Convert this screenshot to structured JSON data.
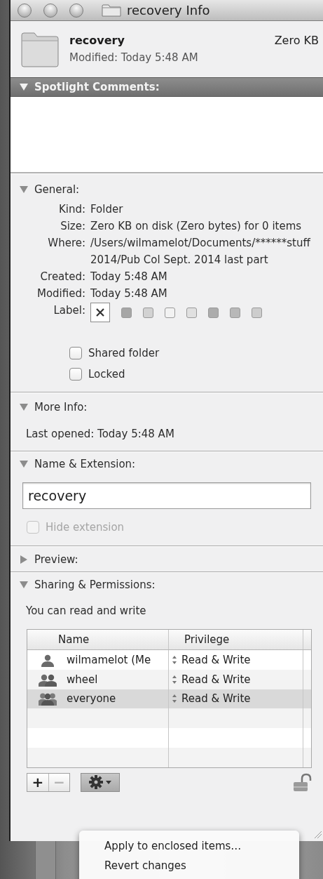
{
  "window": {
    "title": "recovery Info"
  },
  "header": {
    "name": "recovery",
    "size": "Zero KB",
    "modified": "Modified: Today 5:48 AM"
  },
  "spotlight_comments": {
    "title": "Spotlight Comments:",
    "expanded": true
  },
  "general": {
    "title": "General:",
    "expanded": true,
    "fields": [
      {
        "label": "Kind:",
        "value": "Folder"
      },
      {
        "label": "Size:",
        "value": "Zero KB on disk (Zero bytes) for 0 items"
      },
      {
        "label": "Where:",
        "value": "/Users/wilmamelot/Documents/******stuff 2014/Pub Col Sept. 2014 last part"
      },
      {
        "label": "Created:",
        "value": "Today 5:48 AM"
      },
      {
        "label": "Modified:",
        "value": "Today 5:48 AM"
      }
    ],
    "label_field": {
      "label": "Label:",
      "options": [
        {
          "kind": "none",
          "selected": true
        },
        {
          "kind": "color",
          "color": "#a6a6a6",
          "selected": false
        },
        {
          "kind": "color",
          "color": "#d2d2d2",
          "selected": false
        },
        {
          "kind": "color",
          "color": "#f2f2f2",
          "selected": false
        },
        {
          "kind": "color",
          "color": "#e0e0e0",
          "selected": false
        },
        {
          "kind": "color",
          "color": "#acacac",
          "selected": false
        },
        {
          "kind": "color",
          "color": "#b8b8b8",
          "selected": false
        },
        {
          "kind": "color",
          "color": "#cdcdcd",
          "selected": false
        }
      ]
    },
    "checkboxes": [
      {
        "label": "Shared folder",
        "checked": false
      },
      {
        "label": "Locked",
        "checked": false
      }
    ]
  },
  "more_info": {
    "title": "More Info:",
    "expanded": true,
    "last_opened": "Last opened: Today 5:48 AM"
  },
  "name_extension": {
    "title": "Name & Extension:",
    "expanded": true,
    "name_value": "recovery",
    "hide_extension": {
      "label": "Hide extension",
      "checked": false,
      "disabled": true
    }
  },
  "preview": {
    "title": "Preview:",
    "expanded": false
  },
  "sharing": {
    "title": "Sharing & Permissions:",
    "expanded": true,
    "summary": "You can read and write",
    "columns": [
      "Name",
      "Privilege"
    ],
    "rows": [
      {
        "kind": "user",
        "name": "wilmamelot (Me",
        "privilege": "Read & Write",
        "selected": false
      },
      {
        "kind": "group",
        "name": "wheel",
        "privilege": "Read & Write",
        "selected": false
      },
      {
        "kind": "everyone",
        "name": "everyone",
        "privilege": "Read & Write",
        "selected": true
      }
    ],
    "add_button": {
      "label": "+",
      "disabled": false
    },
    "remove_button": {
      "label": "−",
      "disabled": true
    },
    "locked": false
  },
  "menu": {
    "items": [
      "Apply to enclosed items…",
      "Revert changes"
    ]
  }
}
